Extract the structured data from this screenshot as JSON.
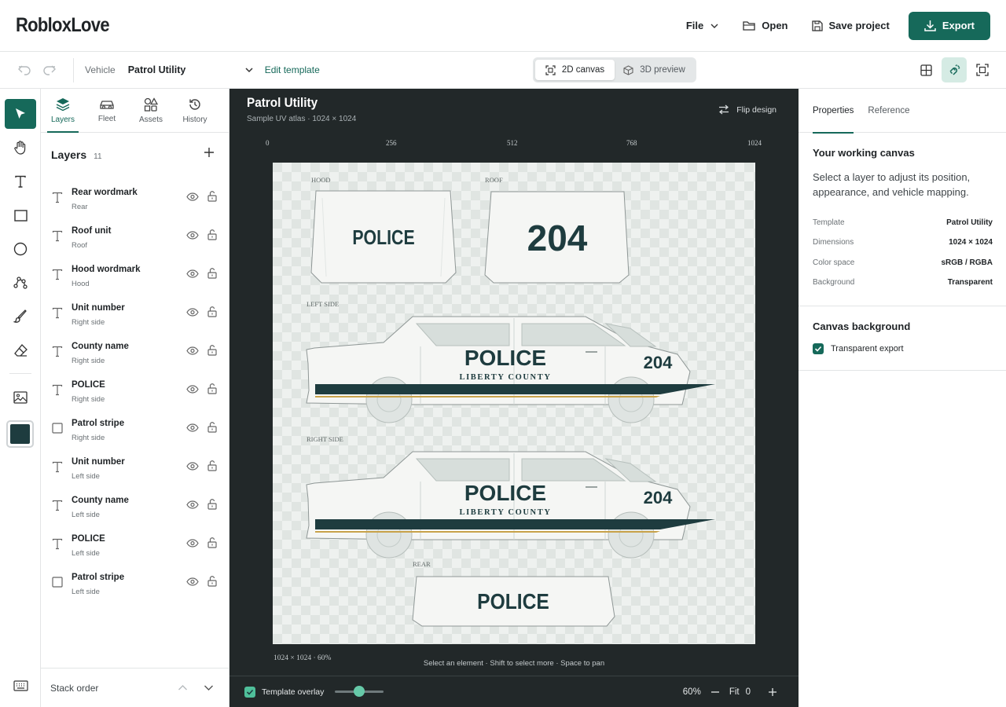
{
  "app": {
    "logo": "RobloxLove",
    "menu": {
      "file": "File",
      "open": "Open",
      "save": "Save project",
      "export": "Export"
    }
  },
  "toolbar": {
    "vehicle_label": "Vehicle",
    "vehicle_value": "Patrol Utility",
    "edit_template": "Edit template",
    "view_2d": "2D canvas",
    "view_3d": "3D preview",
    "active_view": "2D canvas"
  },
  "panel": {
    "tabs": [
      {
        "label": "Layers",
        "icon": "layers-icon",
        "active": true
      },
      {
        "label": "Fleet",
        "icon": "car-icon",
        "active": false
      },
      {
        "label": "Assets",
        "icon": "shapes-icon",
        "active": false
      },
      {
        "label": "History",
        "icon": "history-icon",
        "active": false
      }
    ],
    "title": "Layers",
    "count": "11",
    "layers": [
      {
        "name": "Rear wordmark",
        "sub": "Rear",
        "type": "text"
      },
      {
        "name": "Roof unit",
        "sub": "Roof",
        "type": "text"
      },
      {
        "name": "Hood wordmark",
        "sub": "Hood",
        "type": "text"
      },
      {
        "name": "Unit number",
        "sub": "Right side",
        "type": "text"
      },
      {
        "name": "County name",
        "sub": "Right side",
        "type": "text"
      },
      {
        "name": "POLICE",
        "sub": "Right side",
        "type": "text"
      },
      {
        "name": "Patrol stripe",
        "sub": "Right side",
        "type": "shape"
      },
      {
        "name": "Unit number",
        "sub": "Left side",
        "type": "text"
      },
      {
        "name": "County name",
        "sub": "Left side",
        "type": "text"
      },
      {
        "name": "POLICE",
        "sub": "Left side",
        "type": "text"
      },
      {
        "name": "Patrol stripe",
        "sub": "Left side",
        "type": "shape"
      }
    ],
    "stack_order": "Stack order"
  },
  "canvas": {
    "title": "Patrol Utility",
    "subtitle": "Sample UV atlas · 1024 × 1024",
    "flip": "Flip design",
    "ruler": [
      "0",
      "256",
      "512",
      "768",
      "1024"
    ],
    "labels": {
      "hood": "HOOD",
      "roof": "ROOF",
      "left": "LEFT SIDE",
      "right": "RIGHT SIDE",
      "rear": "REAR"
    },
    "art": {
      "police": "POLICE",
      "unit": "204",
      "county": "LIBERTY COUNTY"
    },
    "dims": "1024 × 1024 · 60%",
    "hint": "Select an element · Shift to select more · Space to pan",
    "overlay_label": "Template overlay",
    "overlay_opacity": 0.5,
    "zoom": "60%",
    "fit": "Fit",
    "fit_value": "0",
    "colors": {
      "livery": "#1e3c3f",
      "stripe_accent": "#c8a24a",
      "accent": "#16695a"
    }
  },
  "props": {
    "tabs": [
      "Properties",
      "Reference"
    ],
    "heading": "Your working canvas",
    "desc": "Select a layer to adjust its position, appearance, and vehicle mapping.",
    "rows": [
      {
        "k": "Template",
        "v": "Patrol Utility"
      },
      {
        "k": "Dimensions",
        "v": "1024 × 1024"
      },
      {
        "k": "Color space",
        "v": "sRGB / RGBA"
      },
      {
        "k": "Background",
        "v": "Transparent"
      }
    ],
    "bg_heading": "Canvas background",
    "transparent_label": "Transparent export"
  }
}
